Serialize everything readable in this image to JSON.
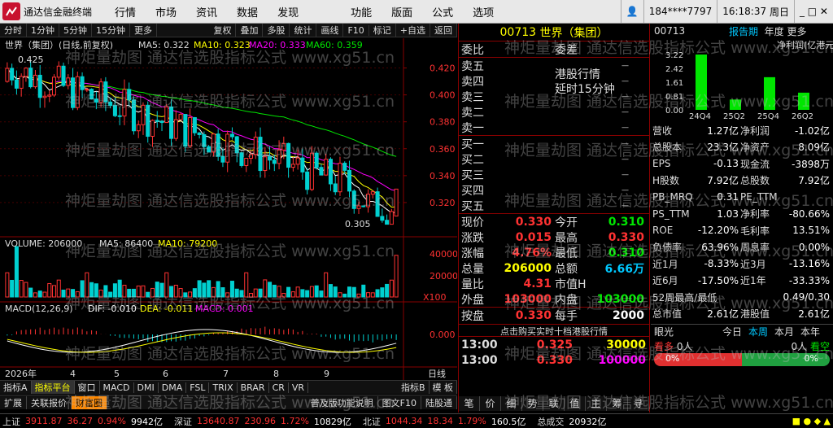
{
  "app": {
    "title": "通达信金融终端",
    "menu": [
      "行情",
      "市场",
      "资讯",
      "数据",
      "发现",
      "功能",
      "版面",
      "公式",
      "选项"
    ],
    "user": "184****7797",
    "time": "16:18:37",
    "weekday": "周日"
  },
  "chart_toolbar": {
    "periods": [
      "分时",
      "1分钟",
      "5分钟",
      "15分钟",
      "更多"
    ],
    "actions": [
      "复权",
      "叠加",
      "多股",
      "统计",
      "画线",
      "F10",
      "标记",
      "+自选",
      "返回"
    ]
  },
  "kline": {
    "title": "世界（集团）(日线,前复权)",
    "ma5": "MA5: 0.322",
    "ma10": "MA10: 0.323",
    "ma20": "MA20: 0.333",
    "ma60": "MA60: 0.359",
    "high_label": "0.425",
    "low_label": "0.305",
    "y_ticks": [
      "0.420",
      "0.400",
      "0.380",
      "0.360",
      "0.340",
      "0.320"
    ]
  },
  "volume": {
    "label": "VOLUME: 206000",
    "ma5": "MA5: 86400",
    "ma10": "MA10: 79200",
    "y_ticks": [
      "40000",
      "20000"
    ],
    "unit": "X100"
  },
  "macd": {
    "label": "MACD(12,26,9)",
    "dif": "DIF: -0.010",
    "dea": "DEA: -0.011",
    "macd": "MACD: 0.001",
    "y_ticks": [
      "0.000"
    ]
  },
  "time_axis": {
    "labels": [
      "2026年",
      "4",
      "5",
      "6",
      "7",
      "8",
      "9"
    ],
    "cycle": "日线"
  },
  "bottom_tabs": [
    "指标A",
    "指标平台",
    "窗口",
    "MACD",
    "DMI",
    "DMA",
    "FSL",
    "TRIX",
    "BRAR",
    "CR",
    "VR",
    "指标B",
    "模 板"
  ],
  "bottom_tabs2": [
    "扩展",
    "关联报价",
    "财富圈",
    "普及版功能说明",
    "图文F10",
    "陆股通"
  ],
  "quote": {
    "code": "00713",
    "name": "世界（集团）",
    "weibi_label": "委比",
    "weicha_label": "委差",
    "sell_levels": [
      "卖五",
      "卖四",
      "卖三",
      "卖二",
      "卖一"
    ],
    "buy_levels": [
      "买一",
      "买二",
      "买三",
      "买四",
      "买五"
    ],
    "notice1": "港股行情",
    "notice2": "延时15分钟",
    "fields": [
      {
        "l1": "现价",
        "v1": "0.330",
        "c1": "red",
        "l2": "今开",
        "v2": "0.310",
        "c2": "grn"
      },
      {
        "l1": "涨跌",
        "v1": "0.015",
        "c1": "red",
        "l2": "最高",
        "v2": "0.330",
        "c2": "red"
      },
      {
        "l1": "涨幅",
        "v1": "4.76%",
        "c1": "red",
        "l2": "最低",
        "v2": "0.310",
        "c2": "grn"
      },
      {
        "l1": "总量",
        "v1": "206000",
        "c1": "yel",
        "l2": "总额",
        "v2": "6.66万",
        "c2": "cyn"
      },
      {
        "l1": "量比",
        "v1": "4.31",
        "c1": "red",
        "l2": "市值H",
        "v2": "",
        "c2": "wht"
      },
      {
        "l1": "外盘",
        "v1": "103000",
        "c1": "red",
        "l2": "内盘",
        "v2": "103000",
        "c2": "grn"
      },
      {
        "l1": "按盘",
        "v1": "0.330",
        "c1": "red",
        "l2": "每手",
        "v2": "2000",
        "c2": "wht"
      }
    ],
    "ticks_hint": "点击购买实时十档港股行情",
    "ticks": [
      {
        "t": "13:00",
        "p": "0.325",
        "pc": "red",
        "v": "30000",
        "vc": "yel"
      },
      {
        "t": "13:00",
        "p": "0.330",
        "pc": "red",
        "v": "100000",
        "vc": "mag"
      }
    ],
    "side_tabs": [
      "笔",
      "价",
      "细",
      "势",
      "联",
      "值",
      "主",
      "筹",
      "寻"
    ]
  },
  "fin": {
    "code": "00713",
    "tab1": "报告期",
    "tab2": "年度",
    "tab3": "更多",
    "unit": "净利润(亿港元)",
    "y_ticks": [
      "3.22",
      "2.42",
      "1.61",
      "0.81",
      "0.00"
    ],
    "bars": [
      {
        "label": "24Q4",
        "value": 3.22
      },
      {
        "label": "25Q2",
        "value": 0.6
      },
      {
        "label": "25Q4",
        "value": 1.9
      },
      {
        "label": "26Q2",
        "value": 1.0
      }
    ],
    "rows": [
      {
        "l1": "营收",
        "v1": "1.27亿",
        "l2": "净利润",
        "v2": "-1.02亿"
      },
      {
        "l1": "总股本",
        "v1": "23.3亿",
        "l2": "净资产",
        "v2": "8.09亿"
      },
      {
        "l1": "EPS",
        "v1": "-0.13",
        "l2": "现金流",
        "v2": "-3898万"
      },
      {
        "l1": "H股数",
        "v1": "7.92亿",
        "l2": "总股数",
        "v2": "7.92亿"
      },
      {
        "l1": "PB_MRQ",
        "v1": "0.31",
        "l2": "PE_TTM",
        "v2": ""
      },
      {
        "l1": "PS_TTM",
        "v1": "1.03",
        "l2": "净利率",
        "v2": "-80.66%"
      },
      {
        "l1": "ROE",
        "v1": "-12.20%",
        "l2": "毛利率",
        "v2": "13.51%"
      },
      {
        "l1": "负债率",
        "v1": "63.96%",
        "l2": "周息率",
        "v2": "0.00%"
      },
      {
        "l1": "近1月",
        "v1": "-8.33%",
        "l2": "近3月",
        "v2": "-13.16%"
      },
      {
        "l1": "近6月",
        "v1": "-17.50%",
        "l2": "近1年",
        "v2": "-33.33%"
      },
      {
        "l1": "52周最高/最低",
        "v1": "",
        "l2": "",
        "v2": "0.49/0.30"
      },
      {
        "l1": "总市值",
        "v1": "2.61亿",
        "l2": "港股值",
        "v2": "2.61亿"
      }
    ],
    "period_tabs": [
      "今日",
      "本周",
      "本月",
      "本年"
    ],
    "sentiment_label": "眼光",
    "bull_label": "看多",
    "bull_count": "0人",
    "bull_pct": "0%",
    "bear_pct": "0%",
    "bear_count": "0人",
    "bear_label": "看空"
  },
  "statusbar": [
    {
      "name": "上证",
      "val": "3911.87",
      "chg": "36.27",
      "pct": "0.94%",
      "amt": "9942亿"
    },
    {
      "name": "深证",
      "val": "13640.87",
      "chg": "230.96",
      "pct": "1.72%",
      "amt": "10829亿"
    },
    {
      "name": "北证",
      "val": "1044.34",
      "chg": "18.34",
      "pct": "1.79%",
      "amt": "160.5亿"
    },
    {
      "name": "总成交",
      "val": "",
      "chg": "",
      "pct": "",
      "amt": "20932亿"
    }
  ],
  "watermark": "神炬量劫图 通达信选股指标公式 www.xg51.cn"
}
